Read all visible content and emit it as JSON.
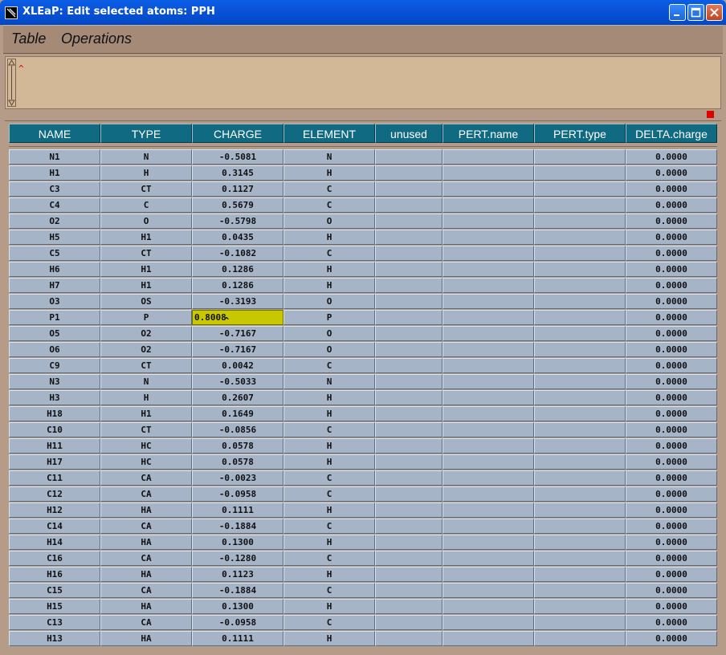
{
  "window": {
    "title": "XLEaP: Edit selected atoms: PPH"
  },
  "menubar": {
    "items": [
      "Table",
      "Operations"
    ]
  },
  "input": {
    "caret": "^"
  },
  "table": {
    "columns": [
      "NAME",
      "TYPE",
      "CHARGE",
      "ELEMENT",
      "unused",
      "PERT.name",
      "PERT.type",
      "DELTA.charge"
    ],
    "editing_row": 10,
    "editing_cursor": "^",
    "rows": [
      [
        "N1",
        "N",
        "-0.5081",
        "N",
        "",
        "",
        "",
        "0.0000"
      ],
      [
        "H1",
        "H",
        "0.3145",
        "H",
        "",
        "",
        "",
        "0.0000"
      ],
      [
        "C3",
        "CT",
        "0.1127",
        "C",
        "",
        "",
        "",
        "0.0000"
      ],
      [
        "C4",
        "C",
        "0.5679",
        "C",
        "",
        "",
        "",
        "0.0000"
      ],
      [
        "O2",
        "O",
        "-0.5798",
        "O",
        "",
        "",
        "",
        "0.0000"
      ],
      [
        "H5",
        "H1",
        "0.0435",
        "H",
        "",
        "",
        "",
        "0.0000"
      ],
      [
        "C5",
        "CT",
        "-0.1082",
        "C",
        "",
        "",
        "",
        "0.0000"
      ],
      [
        "H6",
        "H1",
        "0.1286",
        "H",
        "",
        "",
        "",
        "0.0000"
      ],
      [
        "H7",
        "H1",
        "0.1286",
        "H",
        "",
        "",
        "",
        "0.0000"
      ],
      [
        "O3",
        "OS",
        "-0.3193",
        "O",
        "",
        "",
        "",
        "0.0000"
      ],
      [
        "P1",
        "P",
        "0.8008",
        "P",
        "",
        "",
        "",
        "0.0000"
      ],
      [
        "O5",
        "O2",
        "-0.7167",
        "O",
        "",
        "",
        "",
        "0.0000"
      ],
      [
        "O6",
        "O2",
        "-0.7167",
        "O",
        "",
        "",
        "",
        "0.0000"
      ],
      [
        "C9",
        "CT",
        "0.0042",
        "C",
        "",
        "",
        "",
        "0.0000"
      ],
      [
        "N3",
        "N",
        "-0.5033",
        "N",
        "",
        "",
        "",
        "0.0000"
      ],
      [
        "H3",
        "H",
        "0.2607",
        "H",
        "",
        "",
        "",
        "0.0000"
      ],
      [
        "H18",
        "H1",
        "0.1649",
        "H",
        "",
        "",
        "",
        "0.0000"
      ],
      [
        "C10",
        "CT",
        "-0.0856",
        "C",
        "",
        "",
        "",
        "0.0000"
      ],
      [
        "H11",
        "HC",
        "0.0578",
        "H",
        "",
        "",
        "",
        "0.0000"
      ],
      [
        "H17",
        "HC",
        "0.0578",
        "H",
        "",
        "",
        "",
        "0.0000"
      ],
      [
        "C11",
        "CA",
        "-0.0023",
        "C",
        "",
        "",
        "",
        "0.0000"
      ],
      [
        "C12",
        "CA",
        "-0.0958",
        "C",
        "",
        "",
        "",
        "0.0000"
      ],
      [
        "H12",
        "HA",
        "0.1111",
        "H",
        "",
        "",
        "",
        "0.0000"
      ],
      [
        "C14",
        "CA",
        "-0.1884",
        "C",
        "",
        "",
        "",
        "0.0000"
      ],
      [
        "H14",
        "HA",
        "0.1300",
        "H",
        "",
        "",
        "",
        "0.0000"
      ],
      [
        "C16",
        "CA",
        "-0.1280",
        "C",
        "",
        "",
        "",
        "0.0000"
      ],
      [
        "H16",
        "HA",
        "0.1123",
        "H",
        "",
        "",
        "",
        "0.0000"
      ],
      [
        "C15",
        "CA",
        "-0.1884",
        "C",
        "",
        "",
        "",
        "0.0000"
      ],
      [
        "H15",
        "HA",
        "0.1300",
        "H",
        "",
        "",
        "",
        "0.0000"
      ],
      [
        "C13",
        "CA",
        "-0.0958",
        "C",
        "",
        "",
        "",
        "0.0000"
      ],
      [
        "H13",
        "HA",
        "0.1111",
        "H",
        "",
        "",
        "",
        "0.0000"
      ]
    ]
  }
}
